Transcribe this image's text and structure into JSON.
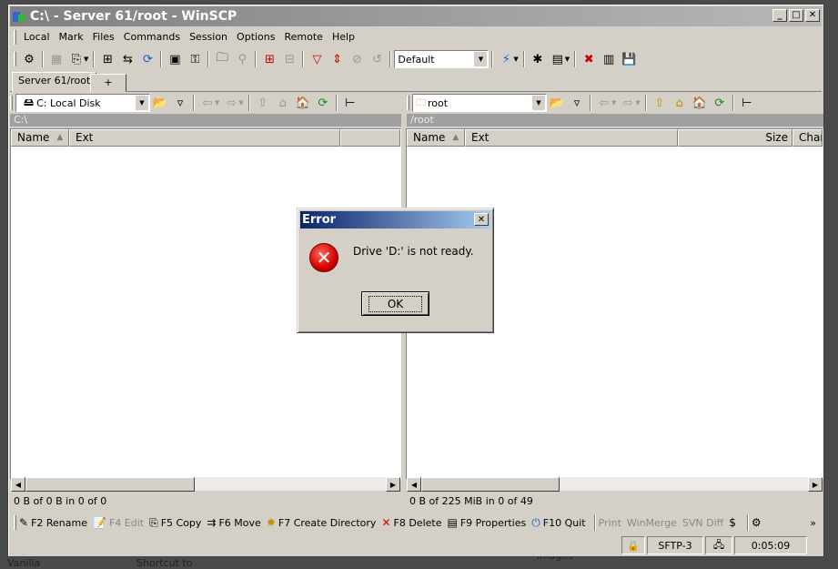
{
  "window": {
    "title": "C:\\ - Server 61/root - WinSCP"
  },
  "menu": [
    "Local",
    "Mark",
    "Files",
    "Commands",
    "Session",
    "Options",
    "Remote",
    "Help"
  ],
  "toolbar": {
    "transfer_profile": "Default"
  },
  "tabs": {
    "active": "Server 61/root",
    "new_tab": "+"
  },
  "left": {
    "drive": "C: Local Disk",
    "path": "C:\\",
    "columns": [
      "Name",
      "Ext"
    ],
    "status": "0 B of 0 B in 0 of 0"
  },
  "right": {
    "folder": "root",
    "path": "/root",
    "columns": [
      "Name",
      "Ext",
      "Size",
      "Char"
    ],
    "status": "0 B of 225 MiB in 0 of 49"
  },
  "keys": [
    {
      "label": "F2 Rename",
      "icon": "rename-icon",
      "enabled": true
    },
    {
      "label": "F4 Edit",
      "icon": "edit-icon",
      "enabled": false
    },
    {
      "label": "F5 Copy",
      "icon": "copy-icon",
      "enabled": true
    },
    {
      "label": "F6 Move",
      "icon": "move-icon",
      "enabled": true
    },
    {
      "label": "F7 Create Directory",
      "icon": "create-directory-icon",
      "enabled": true
    },
    {
      "label": "F8 Delete",
      "icon": "delete-icon",
      "enabled": true
    },
    {
      "label": "F9 Properties",
      "icon": "properties-icon",
      "enabled": true
    },
    {
      "label": "F10 Quit",
      "icon": "quit-icon",
      "enabled": true
    },
    {
      "label": "Print",
      "icon": "",
      "enabled": false
    },
    {
      "label": "WinMerge",
      "icon": "",
      "enabled": false
    },
    {
      "label": "SVN Diff",
      "icon": "",
      "enabled": false
    }
  ],
  "statusbar": {
    "protocol": "SFTP-3",
    "time": "0:05:09"
  },
  "dialog": {
    "title": "Error",
    "message": "Drive 'D:' is not ready.",
    "ok": "OK"
  },
  "background": {
    "frag1": "Vanilla",
    "frag2": "Shortcut to",
    "frag3": "images"
  },
  "colors": {
    "dialog_title": "#0a246a",
    "inactive_title": "#808080",
    "error_red": "#d10000"
  }
}
